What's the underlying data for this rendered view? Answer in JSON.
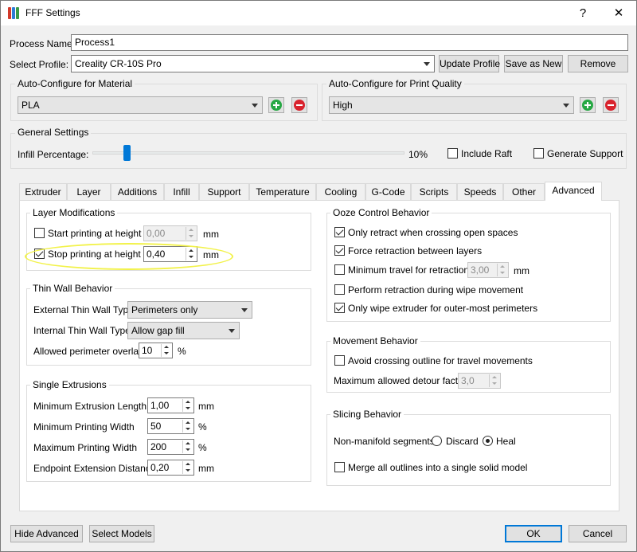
{
  "window": {
    "title": "FFF Settings",
    "help_symbol": "?",
    "close_symbol": "✕"
  },
  "process": {
    "name_label": "Process Name:",
    "name_value": "Process1"
  },
  "profile": {
    "label": "Select Profile:",
    "selected": "Creality CR-10S Pro",
    "update_button": "Update Profile",
    "save_as_new_button": "Save as New",
    "remove_button": "Remove"
  },
  "material": {
    "group_title": "Auto-Configure for Material",
    "selected": "PLA"
  },
  "quality": {
    "group_title": "Auto-Configure for Print Quality",
    "selected": "High"
  },
  "general": {
    "group_title": "General Settings",
    "infill_label": "Infill Percentage:",
    "infill_value_text": "10%",
    "infill_value": 10,
    "include_raft_label": "Include Raft",
    "generate_support_label": "Generate Support"
  },
  "tabs": [
    "Extruder",
    "Layer",
    "Additions",
    "Infill",
    "Support",
    "Temperature",
    "Cooling",
    "G-Code",
    "Scripts",
    "Speeds",
    "Other",
    "Advanced"
  ],
  "layer_mod": {
    "title": "Layer Modifications",
    "start_label": "Start printing at height",
    "start_value": "0,00",
    "stop_label": "Stop printing at height",
    "stop_value": "0,40",
    "unit": "mm"
  },
  "thin_wall": {
    "title": "Thin Wall Behavior",
    "external_label": "External Thin Wall Type",
    "external_value": "Perimeters only",
    "internal_label": "Internal Thin Wall Type",
    "internal_value": "Allow gap fill",
    "overlap_label": "Allowed perimeter overlap",
    "overlap_value": "10",
    "overlap_unit": "%"
  },
  "single_ext": {
    "title": "Single Extrusions",
    "min_length_label": "Minimum Extrusion Length",
    "min_length_value": "1,00",
    "min_length_unit": "mm",
    "min_width_label": "Minimum Printing Width",
    "min_width_value": "50",
    "min_width_unit": "%",
    "max_width_label": "Maximum Printing Width",
    "max_width_value": "200",
    "max_width_unit": "%",
    "endpoint_label": "Endpoint Extension Distance",
    "endpoint_value": "0,20",
    "endpoint_unit": "mm"
  },
  "ooze": {
    "title": "Ooze Control Behavior",
    "only_retract_label": "Only retract when crossing open spaces",
    "force_retract_label": "Force retraction between layers",
    "min_travel_label": "Minimum travel for retraction",
    "min_travel_value": "3,00",
    "min_travel_unit": "mm",
    "wipe_retract_label": "Perform retraction during wipe movement",
    "only_wipe_label": "Only wipe extruder for outer-most perimeters"
  },
  "movement": {
    "title": "Movement Behavior",
    "avoid_label": "Avoid crossing outline for travel movements",
    "detour_label": "Maximum allowed detour factor",
    "detour_value": "3,0"
  },
  "slicing": {
    "title": "Slicing Behavior",
    "nonmanifold_label": "Non-manifold segments:",
    "discard_label": "Discard",
    "heal_label": "Heal",
    "merge_label": "Merge all outlines into a single solid model"
  },
  "footer": {
    "hide_advanced": "Hide Advanced",
    "select_models": "Select Models",
    "ok": "OK",
    "cancel": "Cancel"
  },
  "colors": {
    "accent": "#0078d7",
    "add_green": "#27a844",
    "remove_red": "#d9232d",
    "highlight_yellow": "#f2f24a"
  }
}
